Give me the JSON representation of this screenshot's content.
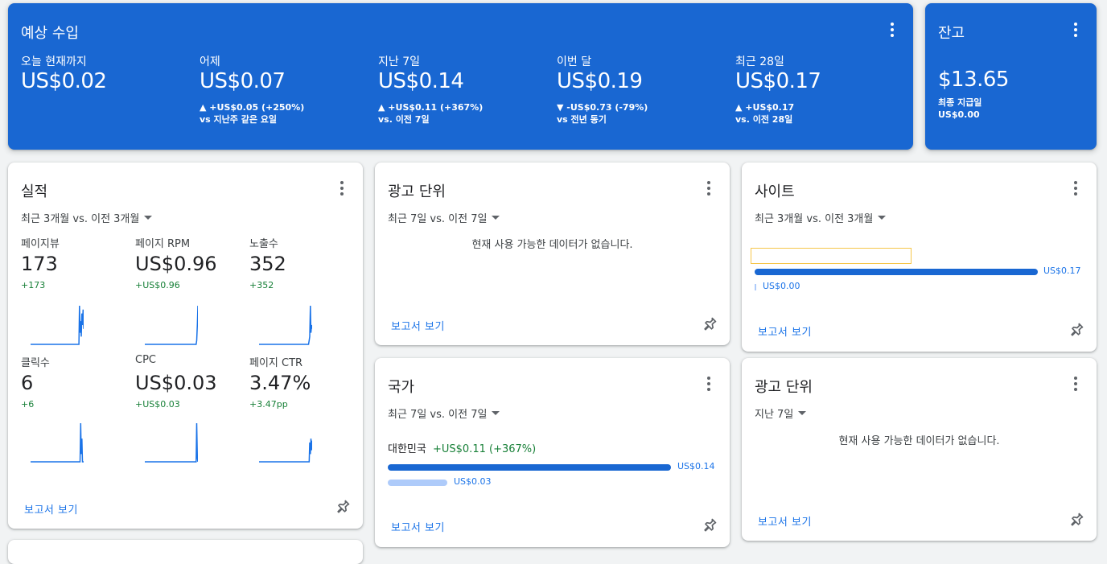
{
  "estimated": {
    "title": "예상 수입",
    "metrics": [
      {
        "label": "오늘 현재까지",
        "value": "US$0.02",
        "delta": "",
        "compare": ""
      },
      {
        "label": "어제",
        "value": "US$0.07",
        "delta": "▲ +US$0.05 (+250%)",
        "compare": "vs 지난주 같은 요일"
      },
      {
        "label": "지난 7일",
        "value": "US$0.14",
        "delta": "▲ +US$0.11 (+367%)",
        "compare": "vs. 이전 7일"
      },
      {
        "label": "이번 달",
        "value": "US$0.19",
        "delta": "▼ -US$0.73 (-79%)",
        "compare": "vs 전년 동기"
      },
      {
        "label": "최근 28일",
        "value": "US$0.17",
        "delta": "▲ +US$0.17",
        "compare": "vs. 이전 28일"
      }
    ]
  },
  "balance": {
    "title": "잔고",
    "value": "$13.65",
    "sub_label": "최종 지급일",
    "sub_value": "US$0.00"
  },
  "performance": {
    "title": "실적",
    "range": "최근 3개월 vs. 이전 3개월",
    "metrics": [
      {
        "label": "페이지뷰",
        "value": "173",
        "delta": "+173",
        "spark": [
          0,
          0,
          0,
          0,
          0,
          0,
          0,
          0,
          0,
          0,
          0,
          0,
          0,
          0,
          0,
          0,
          0,
          0,
          0,
          0,
          0,
          0,
          0,
          0,
          0,
          0,
          0,
          0,
          0,
          0,
          0,
          0,
          0,
          0,
          0,
          0,
          0,
          0,
          0,
          0,
          0,
          0,
          0,
          0,
          0,
          0,
          0,
          0,
          0,
          0,
          0,
          0,
          0,
          0,
          0,
          0,
          0,
          0,
          0,
          0,
          0,
          0,
          0,
          0,
          0,
          0,
          0,
          0,
          0,
          0,
          0,
          0,
          0,
          0,
          0,
          0,
          0,
          0,
          0,
          0,
          0,
          0,
          1.0,
          0.3,
          0.6,
          0.2,
          0.8,
          0.5,
          0.9,
          0.4
        ]
      },
      {
        "label": "페이지 RPM",
        "value": "US$0.96",
        "delta": "+US$0.96",
        "spark": [
          0,
          0,
          0,
          0,
          0,
          0,
          0,
          0,
          0,
          0,
          0,
          0,
          0,
          0,
          0,
          0,
          0,
          0,
          0,
          0,
          0,
          0,
          0,
          0,
          0,
          0,
          0,
          0,
          0,
          0,
          0,
          0,
          0,
          0,
          0,
          0,
          0,
          0,
          0,
          0,
          0,
          0,
          0,
          0,
          0,
          0,
          0,
          0,
          0,
          0,
          0,
          0,
          0,
          0,
          0,
          0,
          0,
          0,
          0,
          0,
          0,
          0,
          0,
          0,
          0,
          0,
          0,
          0,
          0,
          0,
          0,
          0,
          0,
          0,
          0,
          0,
          0,
          0,
          0,
          0,
          0,
          0,
          0,
          0,
          0,
          0,
          0.1,
          0.5,
          1.0
        ]
      },
      {
        "label": "노출수",
        "value": "352",
        "delta": "+352",
        "spark": [
          0,
          0,
          0,
          0,
          0,
          0,
          0,
          0,
          0,
          0,
          0,
          0,
          0,
          0,
          0,
          0,
          0,
          0,
          0,
          0,
          0,
          0,
          0,
          0,
          0,
          0,
          0,
          0,
          0,
          0,
          0,
          0,
          0,
          0,
          0,
          0,
          0,
          0,
          0,
          0,
          0,
          0,
          0,
          0,
          0,
          0,
          0,
          0,
          0,
          0,
          0,
          0,
          0,
          0,
          0,
          0,
          0,
          0,
          0,
          0,
          0,
          0,
          0,
          0,
          0,
          0,
          0,
          0,
          0,
          0,
          0,
          0,
          0,
          0,
          0,
          0,
          0,
          0,
          0,
          0,
          0,
          0,
          0,
          0.1,
          0.2,
          1.0,
          0.3,
          0.5,
          0.4
        ]
      },
      {
        "label": "클릭수",
        "value": "6",
        "delta": "+6",
        "spark": [
          0,
          0,
          0,
          0,
          0,
          0,
          0,
          0,
          0,
          0,
          0,
          0,
          0,
          0,
          0,
          0,
          0,
          0,
          0,
          0,
          0,
          0,
          0,
          0,
          0,
          0,
          0,
          0,
          0,
          0,
          0,
          0,
          0,
          0,
          0,
          0,
          0,
          0,
          0,
          0,
          0,
          0,
          0,
          0,
          0,
          0,
          0,
          0,
          0,
          0,
          0,
          0,
          0,
          0,
          0,
          0,
          0,
          0,
          0,
          0,
          0,
          0,
          0,
          0,
          0,
          0,
          0,
          0,
          0,
          0,
          0,
          0,
          0,
          0,
          0,
          0,
          0,
          0,
          0,
          0,
          0,
          0,
          0,
          1.0,
          0.2,
          0.6,
          0,
          0,
          0
        ]
      },
      {
        "label": "CPC",
        "value": "US$0.03",
        "delta": "+US$0.03",
        "spark": [
          0,
          0,
          0,
          0,
          0,
          0,
          0,
          0,
          0,
          0,
          0,
          0,
          0,
          0,
          0,
          0,
          0,
          0,
          0,
          0,
          0,
          0,
          0,
          0,
          0,
          0,
          0,
          0,
          0,
          0,
          0,
          0,
          0,
          0,
          0,
          0,
          0,
          0,
          0,
          0,
          0,
          0,
          0,
          0,
          0,
          0,
          0,
          0,
          0,
          0,
          0,
          0,
          0,
          0,
          0,
          0,
          0,
          0,
          0,
          0,
          0,
          0,
          0,
          0,
          0,
          0,
          0,
          0,
          0,
          0,
          0,
          0,
          0,
          0,
          0,
          0,
          0,
          0,
          0,
          0,
          0,
          0,
          0,
          0,
          0,
          0,
          1.0,
          0.1,
          0
        ]
      },
      {
        "label": "페이지 CTR",
        "value": "3.47%",
        "delta": "+3.47pp",
        "spark": [
          0,
          0,
          0,
          0,
          0,
          0,
          0,
          0,
          0,
          0,
          0,
          0,
          0,
          0,
          0,
          0,
          0,
          0,
          0,
          0,
          0,
          0,
          0,
          0,
          0,
          0,
          0,
          0,
          0,
          0,
          0,
          0,
          0,
          0,
          0,
          0,
          0,
          0,
          0,
          0,
          0,
          0,
          0,
          0,
          0,
          0,
          0,
          0,
          0,
          0,
          0,
          0,
          0,
          0,
          0,
          0,
          0,
          0,
          0,
          0,
          0,
          0,
          0,
          0,
          0,
          0,
          0,
          0,
          0,
          0,
          0,
          0,
          0,
          0,
          0,
          0,
          0,
          0,
          0,
          0,
          0,
          0,
          0,
          0,
          0.5,
          0.2,
          0.6,
          0.3,
          0.55
        ]
      }
    ],
    "report": "보고서 보기"
  },
  "ad_units": {
    "title": "광고 단위",
    "range": "최근 7일 vs. 이전 7일",
    "empty": "현재 사용 가능한 데이터가 없습니다.",
    "report": "보고서 보기"
  },
  "sites": {
    "title": "사이트",
    "range": "최근 3개월 vs. 이전 3개월",
    "bars": [
      {
        "value": "US$0.17",
        "fraction": 1.0,
        "color": "#1967d2"
      },
      {
        "value": "US$0.00",
        "fraction": 0.0,
        "color": "#aecbfa"
      }
    ],
    "report": "보고서 보기"
  },
  "countries": {
    "title": "국가",
    "range": "최근 7일 vs. 이전 7일",
    "country": "대한민국",
    "delta": "+US$0.11 (+367%)",
    "bars": [
      {
        "value": "US$0.14",
        "fraction": 1.0,
        "color": "#1967d2"
      },
      {
        "value": "US$0.03",
        "fraction": 0.21,
        "color": "#aecbfa"
      }
    ],
    "report": "보고서 보기"
  },
  "ad_units_2": {
    "title": "광고 단위",
    "range": "지난 7일",
    "empty": "현재 사용 가능한 데이터가 없습니다.",
    "report": "보고서 보기"
  }
}
